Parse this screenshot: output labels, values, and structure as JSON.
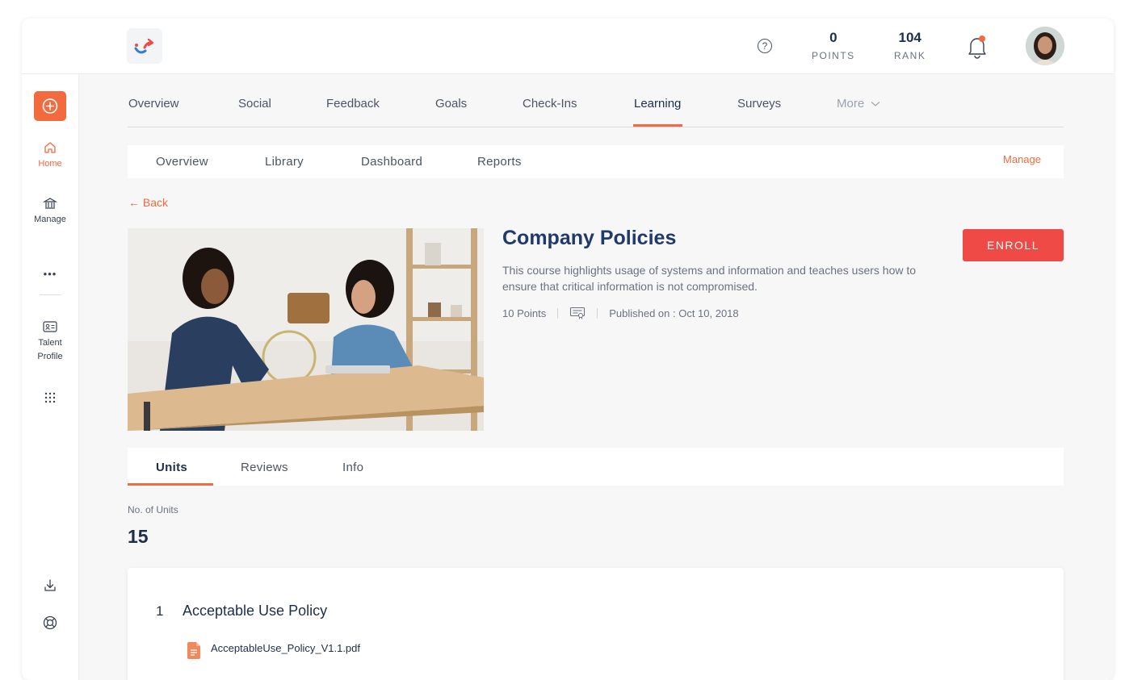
{
  "header": {
    "logo_icon": "app-logo-icon",
    "help_icon": "help-circle-icon",
    "points": {
      "value": "0",
      "label": "POINTS"
    },
    "rank": {
      "value": "104",
      "label": "RANK"
    },
    "notification_icon": "bell-icon",
    "notification_dot_color": "#f26a3d"
  },
  "sidebar": {
    "create_icon": "plus-circle-icon",
    "items": [
      {
        "label": "Home",
        "icon": "home-icon",
        "active": true
      },
      {
        "label": "Manage",
        "icon": "bank-icon"
      },
      {
        "label": "Talent Profile",
        "icon": "id-card-icon"
      }
    ],
    "more_icon": "dots-horizontal-icon",
    "apps_icon": "grid-icon",
    "download_icon": "download-icon",
    "support_icon": "lifebuoy-icon"
  },
  "main_nav": {
    "items": [
      "Overview",
      "Social",
      "Feedback",
      "Goals",
      "Check-Ins",
      "Learning",
      "Surveys",
      "More"
    ],
    "active": "Learning"
  },
  "sub_nav": {
    "items": [
      "Overview",
      "Library",
      "Dashboard",
      "Reports"
    ],
    "manage": "Manage"
  },
  "back": "← Back",
  "course": {
    "title": "Company Policies",
    "description": "This course highlights usage of systems and information and teaches users how to ensure that critical information is not compromised.",
    "points": "10 Points",
    "certificate_icon": "certificate-icon",
    "published": "Published on : Oct 10, 2018",
    "enroll": "ENROLL"
  },
  "tabs": {
    "items": [
      "Units",
      "Reviews",
      "Info"
    ],
    "active": "Units"
  },
  "units": {
    "label": "No. of Units",
    "count": "15",
    "list": [
      {
        "number": "1",
        "title": "Acceptable Use Policy",
        "file": "AcceptableUse_Policy_V1.1.pdf",
        "file_icon": "pdf-file-icon"
      }
    ]
  },
  "colors": {
    "accent": "#f26a3d",
    "enroll": "#ef4a45",
    "title": "#1f3a6b"
  }
}
